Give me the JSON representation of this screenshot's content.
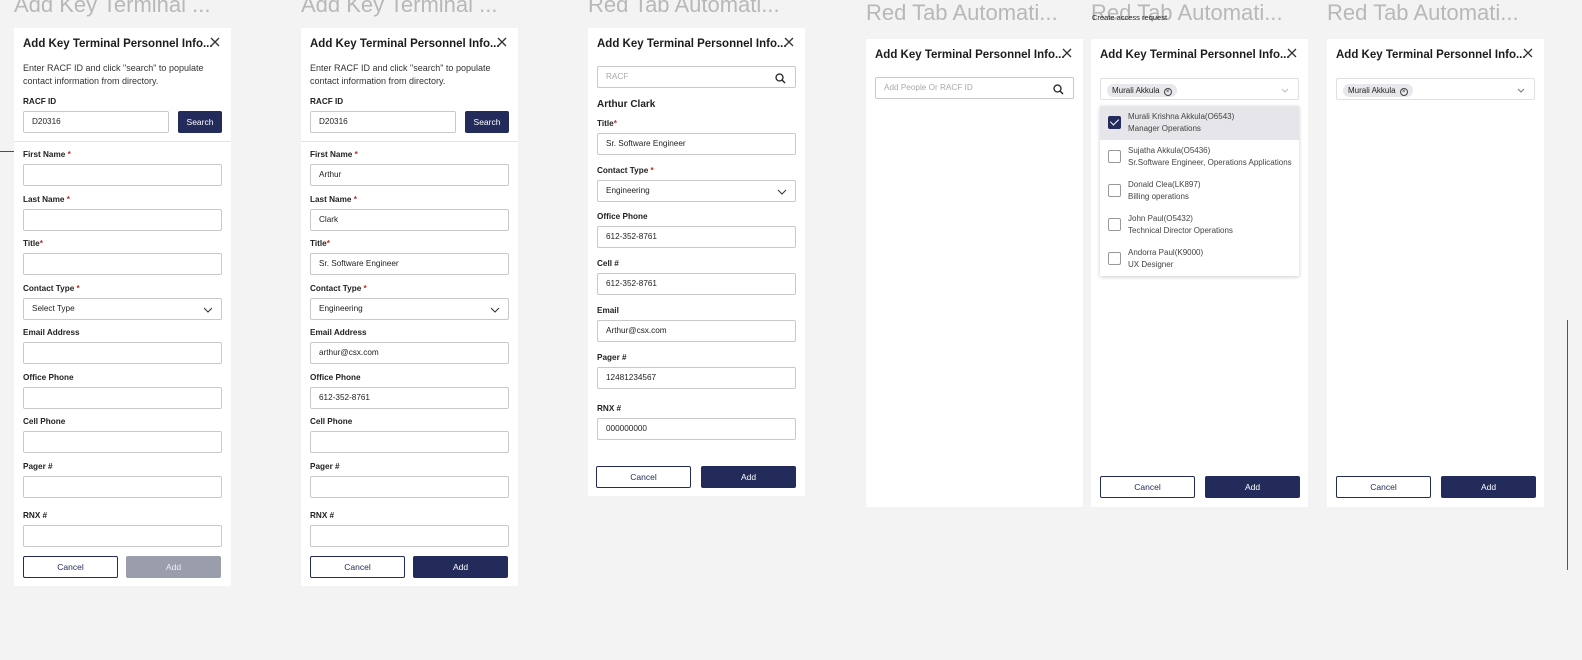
{
  "frame_titles": [
    "Add Key Terminal ...",
    "Add Key Terminal ...",
    "Red Tab Automati...",
    "Red Tab Automati...",
    "Red Tab Automati...",
    "Red Tab Automati..."
  ],
  "create_access_note": "Create access request",
  "panel_title": "Add Key Terminal Personnel Info...",
  "help_text": "Enter RACF ID  and click \"search\" to populate contact information from directory.",
  "labels": {
    "racf_id": "RACF ID",
    "first_name": "First Name",
    "last_name": "Last Name",
    "title": "Title",
    "contact_type": "Contact Type",
    "email_address": "Email Address",
    "office_phone": "Office Phone",
    "cell_phone": "Cell Phone",
    "pager": "Pager #",
    "rnx": "RNX #",
    "cell": "Cell #",
    "email": "Email",
    "required_mark": "*"
  },
  "buttons": {
    "search": "Search",
    "cancel": "Cancel",
    "add": "Add"
  },
  "panel1": {
    "racf_value": "D20316",
    "contact_type_placeholder": "Select Type"
  },
  "panel2": {
    "racf_value": "D20316",
    "first_name": "Arthur",
    "last_name": "Clark",
    "title": "Sr. Software Engineer",
    "contact_type": "Engineering",
    "email": "arthur@csx.com",
    "office_phone": "612-352-8761"
  },
  "panel3": {
    "search_placeholder": "RACF",
    "person_name": "Arthur Clark",
    "title": "Sr. Software Engineer",
    "contact_type": "Engineering",
    "office_phone": "612-352-8761",
    "cell": "612-352-8761",
    "email": "Arthur@csx.com",
    "pager": "12481234567",
    "rnx": "000000000"
  },
  "panel4": {
    "search_placeholder": "Add People Or RACF ID"
  },
  "panel5": {
    "chip": "Murali Akkula",
    "options": [
      {
        "name": "Murali Krishna Akkula(O6543)",
        "role": "Manager Operations",
        "checked": true
      },
      {
        "name": "Sujatha Akkula(O5436)",
        "role": "Sr.Software Engineer, Operations Applications",
        "checked": false
      },
      {
        "name": "Donald Clea(LK897)",
        "role": "Billing operations",
        "checked": false
      },
      {
        "name": "John Paul(O5432)",
        "role": "Technical Director Operations",
        "checked": false
      },
      {
        "name": "Andorra Paul(K9000)",
        "role": "UX Designer",
        "checked": false
      }
    ]
  },
  "panel6": {
    "chip": "Murali Akkula"
  },
  "colors": {
    "primary": "#232b5a",
    "required": "#c52626",
    "disabled": "#9a9dab",
    "background": "#f3f3f3"
  },
  "icons": [
    "close-icon",
    "search-icon",
    "chevron-down-icon",
    "checkbox-icon",
    "remove-chip-icon"
  ]
}
